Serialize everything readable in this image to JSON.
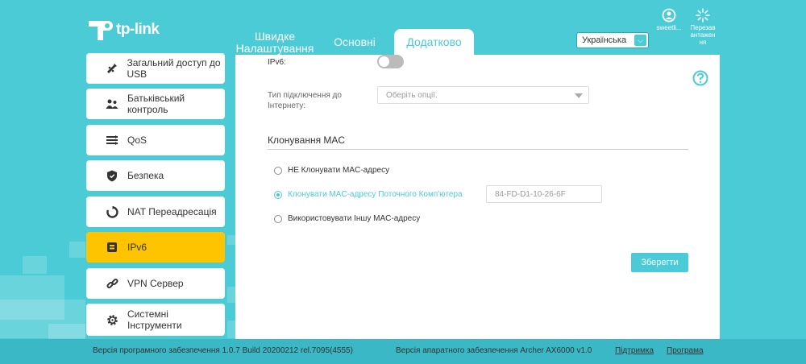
{
  "brand": {
    "logo_text": "tp-link"
  },
  "header": {
    "tabs": [
      {
        "label": "Швидке Налаштування"
      },
      {
        "label": "Основні"
      },
      {
        "label": "Додатково"
      }
    ],
    "language": "Українська",
    "user_label": "sweetli...",
    "reboot_label": "Перезав антажен ня"
  },
  "sidebar": {
    "items": [
      {
        "label": "Загальний доступ до USB",
        "icon": "usb-icon"
      },
      {
        "label": "Батьківський контроль",
        "icon": "parental-control-icon"
      },
      {
        "label": "QoS",
        "icon": "qos-icon"
      },
      {
        "label": "Безпека",
        "icon": "shield-icon"
      },
      {
        "label": "NAT Переадресація",
        "icon": "nat-icon"
      },
      {
        "label": "IPv6",
        "icon": "ipv6-icon",
        "active": true
      },
      {
        "label": "VPN Сервер",
        "icon": "vpn-icon"
      },
      {
        "label": "Системні Інструменти",
        "icon": "gear-icon"
      }
    ]
  },
  "main": {
    "ipv6_label": "IPv6:",
    "ipv6_enabled": false,
    "connection_type_label": "Тип підключення до Інтернету:",
    "connection_type_placeholder": "Оберіть опції.",
    "mac_clone": {
      "title": "Клонування MAC",
      "options": [
        {
          "label": "НЕ Клонувати MAC-адресу",
          "checked": false
        },
        {
          "label": "Клонувати MAC-адресу Поточного Комп'ютера",
          "checked": true
        },
        {
          "label": "Використовувати Іншу MAC-адресу",
          "checked": false
        }
      ],
      "mac_value": "84-FD-D1-10-26-6F"
    },
    "save_label": "Зберегти"
  },
  "footer": {
    "firmware": "Версія програмного забезпечення 1.0.7 Build 20200212 rel.7095(4555)",
    "hardware": "Версія апаратного забезпечення Archer AX6000 v1.0",
    "support_label": "Підтримка",
    "app_label": "Програма"
  },
  "colors": {
    "accent": "#4acbd6",
    "active_item": "#ffc400"
  }
}
